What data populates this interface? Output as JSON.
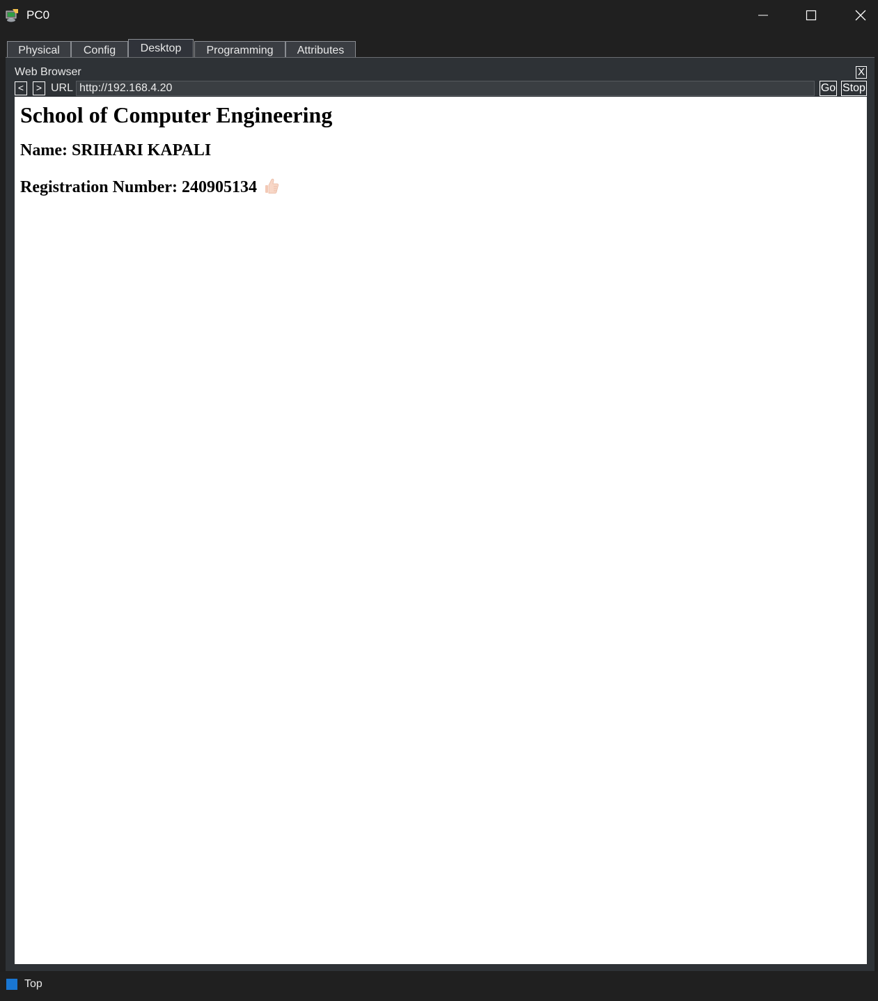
{
  "window": {
    "title": "PC0",
    "app_icon": "packet-tracer-pc-icon",
    "controls": [
      "minimize-icon",
      "maximize-icon",
      "close-icon"
    ]
  },
  "tabs": [
    {
      "label": "Physical",
      "active": false
    },
    {
      "label": "Config",
      "active": false
    },
    {
      "label": "Desktop",
      "active": true
    },
    {
      "label": "Programming",
      "active": false
    },
    {
      "label": "Attributes",
      "active": false
    }
  ],
  "browser": {
    "title": "Web Browser",
    "close_label": "X",
    "back_label": "<",
    "forward_label": ">",
    "url_label": "URL",
    "url_value": "http://192.168.4.20",
    "go_label": "Go",
    "stop_label": "Stop"
  },
  "webpage": {
    "heading": "School of Computer Engineering",
    "name_line": "Name: SRIHARI KAPALI",
    "registration_line": "Registration Number: 240905134",
    "emoji_icon": "thumbs-up-icon"
  },
  "statusbar": {
    "label": "Top",
    "accent_color": "#1976d2"
  }
}
